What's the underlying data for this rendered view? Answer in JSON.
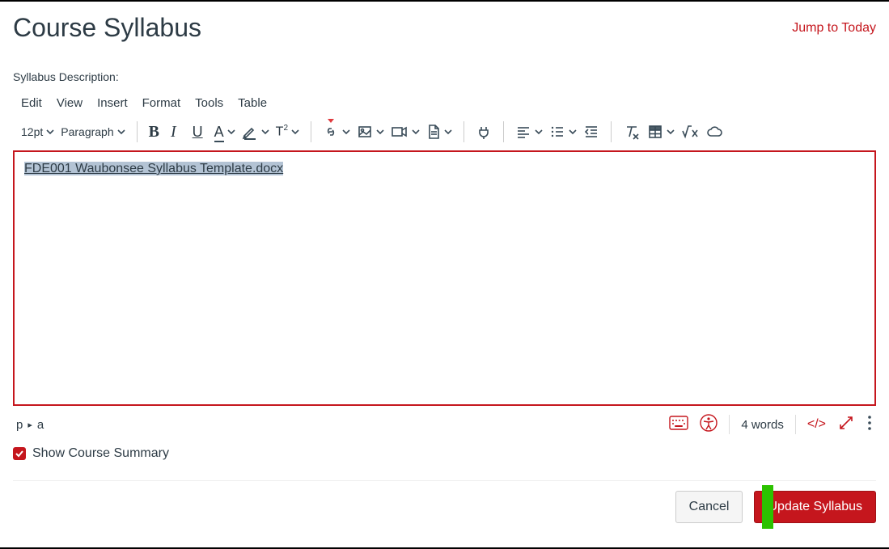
{
  "header": {
    "title": "Course Syllabus",
    "jump_link": "Jump to Today"
  },
  "field_label": "Syllabus Description:",
  "menubar": {
    "edit": "Edit",
    "view": "View",
    "insert": "Insert",
    "format": "Format",
    "tools": "Tools",
    "table": "Table"
  },
  "toolbar": {
    "font_size": "12pt",
    "block_format": "Paragraph"
  },
  "editor": {
    "link_text": "FDE001 Waubonsee Syllabus Template.docx"
  },
  "statusbar": {
    "path_p": "p",
    "path_sep": "▸",
    "path_a": "a",
    "word_count": "4 words",
    "html_view": "</>"
  },
  "options": {
    "show_summary_label": "Show Course Summary"
  },
  "footer": {
    "cancel": "Cancel",
    "update": "Update Syllabus"
  }
}
